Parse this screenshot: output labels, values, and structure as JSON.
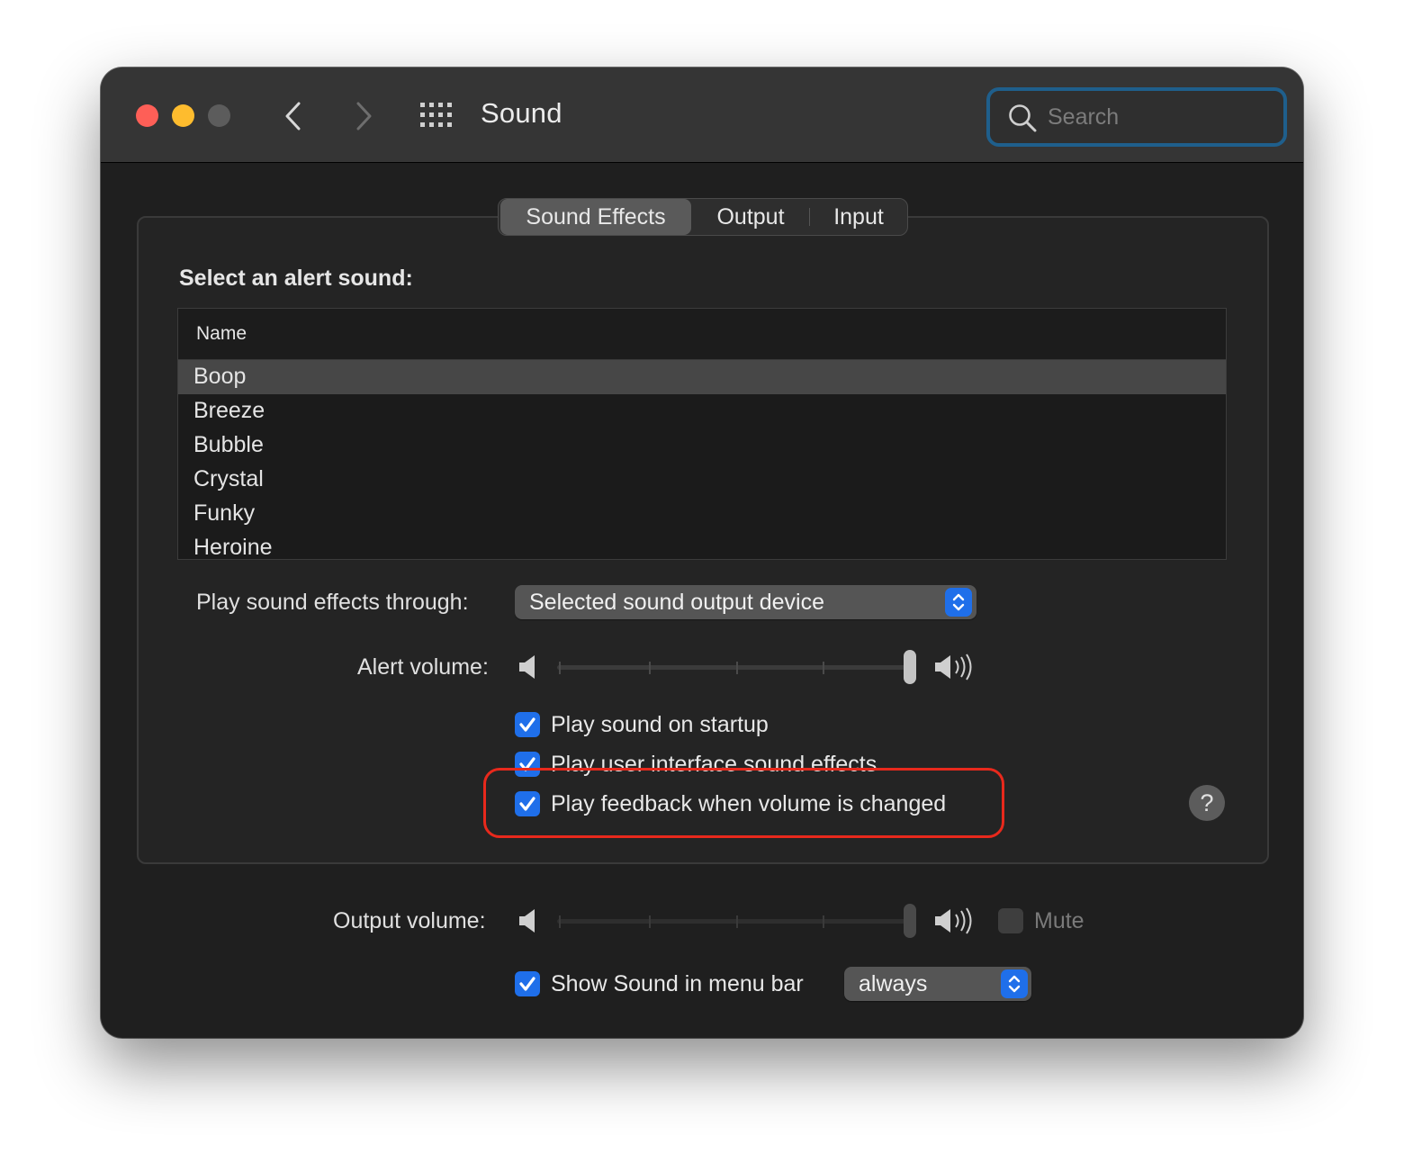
{
  "window": {
    "title": "Sound",
    "search": {
      "placeholder": "Search",
      "value": ""
    }
  },
  "tabs": [
    {
      "label": "Sound Effects",
      "selected": true
    },
    {
      "label": "Output",
      "selected": false
    },
    {
      "label": "Input",
      "selected": false
    }
  ],
  "sound_effects": {
    "section_title": "Select an alert sound:",
    "list_header": "Name",
    "sounds": [
      "Boop",
      "Breeze",
      "Bubble",
      "Crystal",
      "Funky",
      "Heroine"
    ],
    "selected_sound": "Boop",
    "play_through_label": "Play sound effects through:",
    "play_through_value": "Selected sound output device",
    "alert_volume_label": "Alert volume:",
    "alert_volume_level": 1.0,
    "checkboxes": [
      {
        "label": "Play sound on startup",
        "checked": true
      },
      {
        "label": "Play user interface sound effects",
        "checked": true
      },
      {
        "label": "Play feedback when volume is changed",
        "checked": true
      }
    ],
    "help_label": "?"
  },
  "output": {
    "volume_label": "Output volume:",
    "volume_level": 1.0,
    "mute_label": "Mute",
    "mute_checked": false,
    "menu_bar_label": "Show Sound in menu bar",
    "menu_bar_checked": true,
    "menu_bar_value": "always"
  },
  "colors": {
    "accent": "#1f6fea",
    "highlight": "#e8291c",
    "close": "#fe5f57",
    "minimize": "#febc2e"
  },
  "icons": {
    "back": "chevron-left-icon",
    "forward": "chevron-right-icon",
    "grid": "grid-icon",
    "search": "search-icon",
    "speaker_low": "speaker-low-icon",
    "speaker_high": "speaker-high-icon",
    "checkmark": "checkmark-icon",
    "stepper": "up-down-chevron-icon"
  }
}
